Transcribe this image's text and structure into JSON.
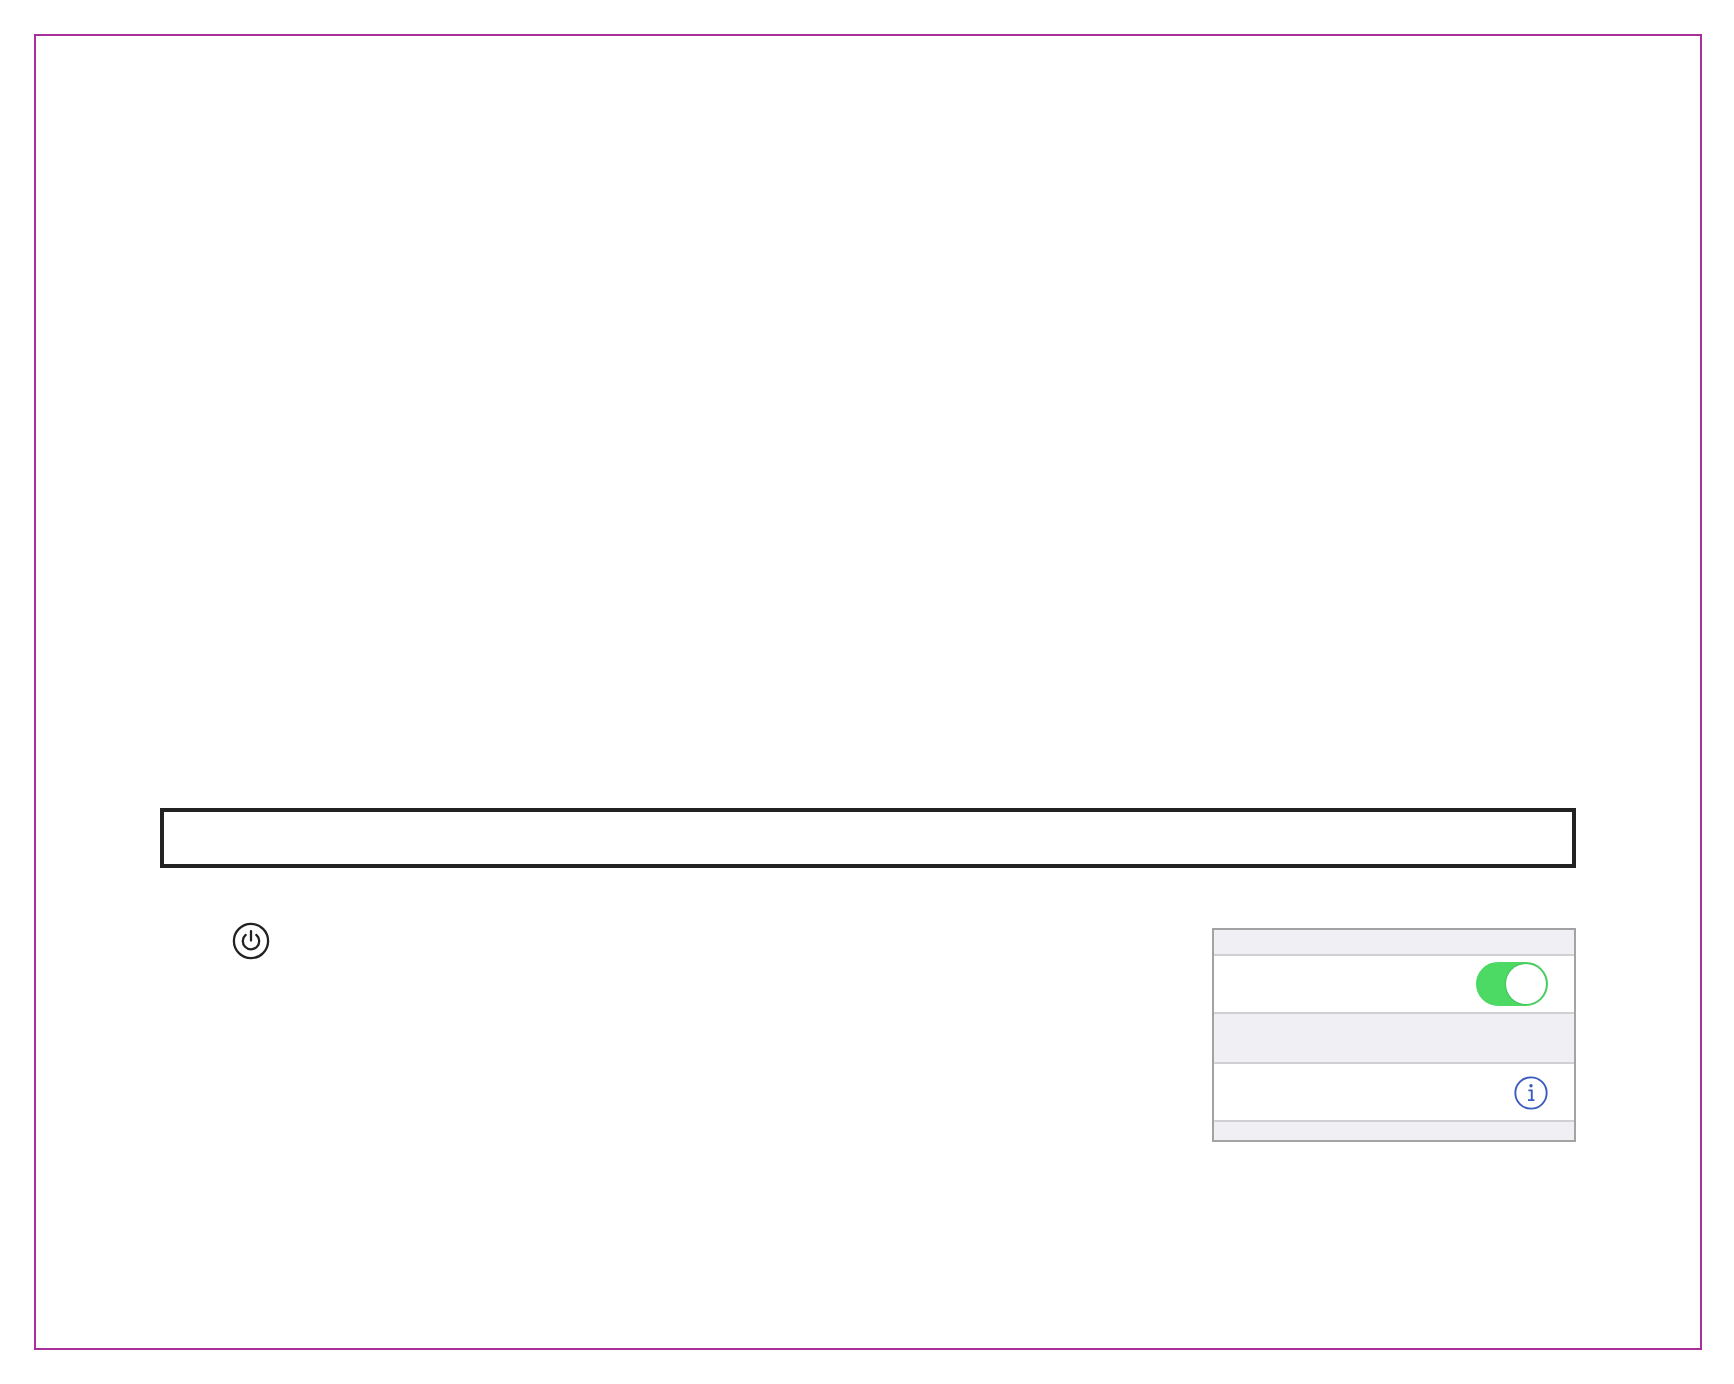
{
  "settings_panel": {
    "rows": [
      {
        "kind": "toggle",
        "on": true
      },
      {
        "kind": "info"
      }
    ]
  }
}
